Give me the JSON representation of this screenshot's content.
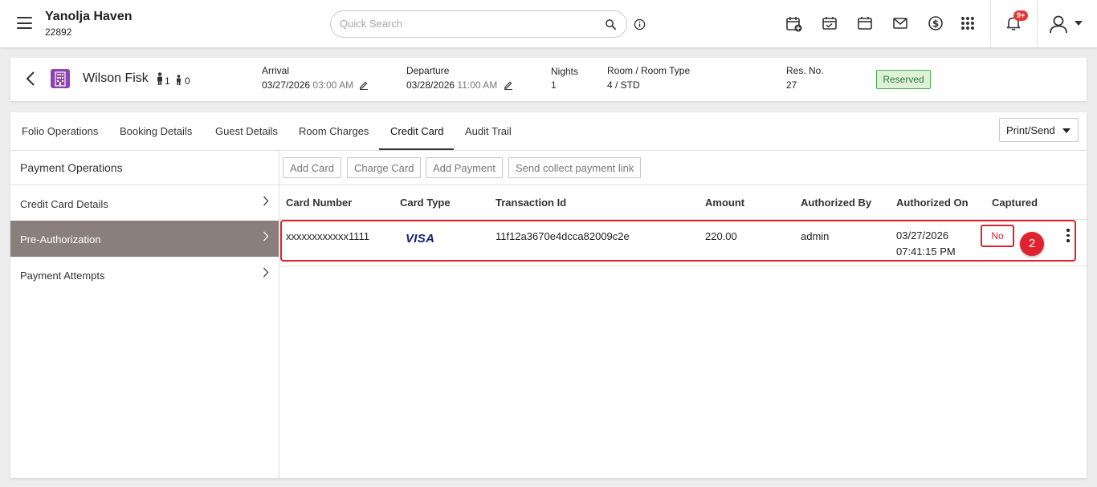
{
  "header": {
    "hotel_name": "Yanolja Haven",
    "hotel_id": "22892",
    "search_placeholder": "Quick Search",
    "notification_count": "9+",
    "icons": [
      "calendar-add-icon",
      "calendar-check-icon",
      "calendar-icon",
      "mail-icon",
      "dollar-icon",
      "apps-grid-icon",
      "bell-icon",
      "user-icon"
    ]
  },
  "reservation": {
    "guest_name": "Wilson Fisk",
    "adults": "1",
    "children": "0",
    "arrival_label": "Arrival",
    "arrival_date": "03/27/2026",
    "arrival_time": "03:00 AM",
    "departure_label": "Departure",
    "departure_date": "03/28/2026",
    "departure_time": "11:00 AM",
    "nights_label": "Nights",
    "nights": "1",
    "room_label": "Room / Room Type",
    "room": "4 / STD",
    "res_no_label": "Res. No.",
    "res_no": "27",
    "status": "Reserved",
    "status_color": "#2e7d32"
  },
  "tabs": [
    "Folio Operations",
    "Booking Details",
    "Guest Details",
    "Room Charges",
    "Credit Card",
    "Audit Trail"
  ],
  "active_tab": "Credit Card",
  "print_send_label": "Print/Send",
  "left_nav": {
    "heading": "Payment Operations",
    "items": [
      "Credit Card Details",
      "Pre-Authorization",
      "Payment Attempts"
    ],
    "active": "Pre-Authorization"
  },
  "actions": [
    "Add Card",
    "Charge Card",
    "Add Payment",
    "Send collect payment link"
  ],
  "table": {
    "columns": [
      "Card Number",
      "Card Type",
      "Transaction Id",
      "Amount",
      "Authorized By",
      "Authorized On",
      "Captured"
    ],
    "rows": [
      {
        "card_number": "xxxxxxxxxxxx1111",
        "card_type": "VISA",
        "transaction_id": "11f12a3670e4dcca82009c2e",
        "amount": "220.00",
        "authorized_by": "admin",
        "authorized_on_date": "03/27/2026",
        "authorized_on_time": "07:41:15 PM",
        "captured": "No"
      }
    ]
  },
  "step_marker": "2",
  "accent_color": "#e0212e"
}
